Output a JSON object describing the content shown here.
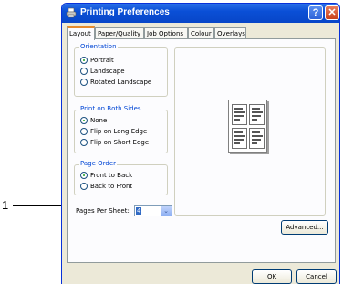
{
  "callout": {
    "number": "1"
  },
  "window": {
    "title": "Printing Preferences",
    "help_glyph": "?",
    "close_glyph": "✕"
  },
  "tabs": [
    {
      "label": "Layout",
      "active": true
    },
    {
      "label": "Paper/Quality",
      "active": false
    },
    {
      "label": "Job Options",
      "active": false
    },
    {
      "label": "Colour",
      "active": false
    },
    {
      "label": "Overlays",
      "active": false
    }
  ],
  "orientation": {
    "title": "Orientation",
    "options": [
      "Portrait",
      "Landscape",
      "Rotated Landscape"
    ],
    "selected": "Portrait"
  },
  "duplex": {
    "title": "Print on Both Sides",
    "options": [
      "None",
      "Flip on Long Edge",
      "Flip on Short Edge"
    ],
    "selected": "None"
  },
  "page_order": {
    "title": "Page Order",
    "options": [
      "Front to Back",
      "Back to Front"
    ],
    "selected": "Front to Back"
  },
  "pages_per_sheet": {
    "label": "Pages Per Sheet:",
    "value": "4",
    "arrow": "⌄"
  },
  "buttons": {
    "advanced": "Advanced...",
    "ok": "OK",
    "cancel": "Cancel"
  },
  "colors": {
    "title_bar": "#0a4fd6",
    "group_title": "#0046d5",
    "selection": "#316ac5",
    "radio_dot": "#21a121"
  },
  "icons": {
    "title": "printer-icon",
    "help": "help-icon",
    "close": "close-icon",
    "dropdown": "chevron-down-icon"
  }
}
